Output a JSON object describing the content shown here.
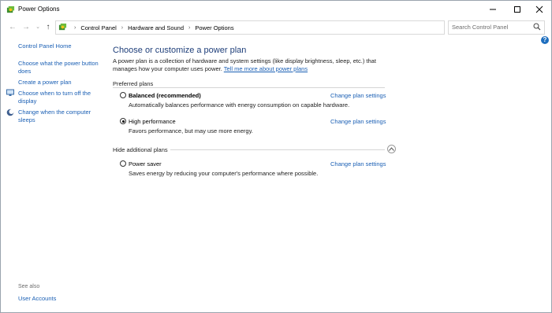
{
  "window": {
    "title": "Power Options"
  },
  "address": {
    "crumbs": [
      "Control Panel",
      "Hardware and Sound",
      "Power Options"
    ],
    "search_placeholder": "Search Control Panel"
  },
  "sidebar": {
    "home": "Control Panel Home",
    "items": [
      {
        "label": "Choose what the power button does"
      },
      {
        "label": "Create a power plan"
      },
      {
        "label": "Choose when to turn off the display"
      },
      {
        "label": "Change when the computer sleeps"
      }
    ],
    "see_also": "See also",
    "user_accounts": "User Accounts"
  },
  "main": {
    "heading": "Choose or customize a power plan",
    "description": "A power plan is a collection of hardware and system settings (like display brightness, sleep, etc.) that manages how your computer uses power.",
    "learn_more": "Tell me more about power plans",
    "preferred_label": "Preferred plans",
    "hide_additional_label": "Hide additional plans",
    "change_settings_label": "Change plan settings",
    "plans": [
      {
        "name": "Balanced (recommended)",
        "description": "Automatically balances performance with energy consumption on capable hardware.",
        "selected": false
      },
      {
        "name": "High performance",
        "description": "Favors performance, but may use more energy.",
        "selected": true
      },
      {
        "name": "Power saver",
        "description": "Saves energy by reducing your computer's performance where possible.",
        "selected": false
      }
    ]
  }
}
